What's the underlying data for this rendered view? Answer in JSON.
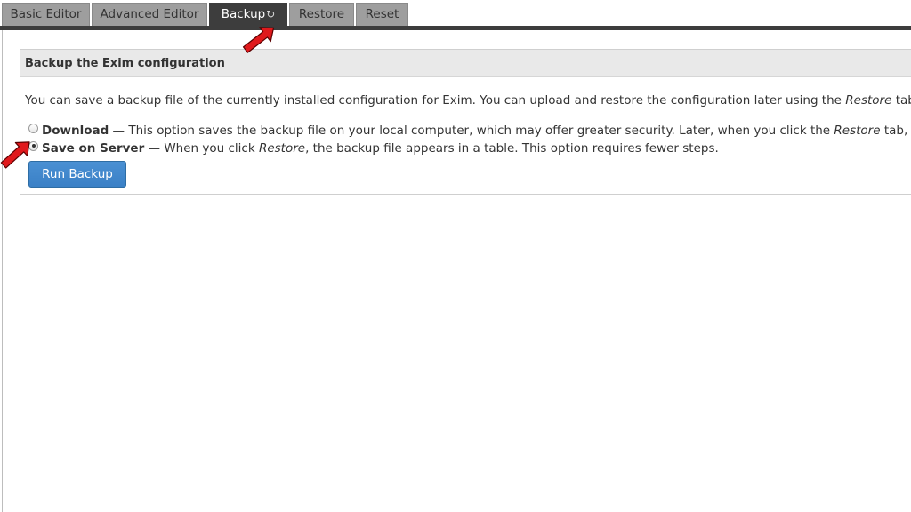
{
  "tabs": {
    "basic_editor": "Basic Editor",
    "advanced_editor": "Advanced Editor",
    "backup": "Backup",
    "restore": "Restore",
    "reset": "Reset"
  },
  "panel": {
    "title": "Backup the Exim configuration",
    "desc_pre": "You can save a backup file of the currently installed configuration for Exim. You can upload and restore the configuration later using the ",
    "desc_em": "Restore",
    "desc_post": " tab."
  },
  "options": {
    "download": {
      "label": "Download",
      "text_pre": " — This option saves the backup file on your local computer, which may offer greater security. Later, when you click the ",
      "text_em": "Restore",
      "text_post": " tab, you will",
      "checked": false
    },
    "server": {
      "label": "Save on Server",
      "text_pre": " — When you click ",
      "text_em": "Restore",
      "text_post": ", the backup file appears in a table. This option requires fewer steps.",
      "checked": true
    }
  },
  "run_button": "Run Backup",
  "icons": {
    "refresh": "refresh-icon",
    "annotation": "red-pointer-arrow"
  },
  "colors": {
    "active_tab": "#3d3d3d",
    "inactive_tab": "#9e9e9e",
    "button": "#3a80c6",
    "annotation_arrow": "#e0191c"
  }
}
